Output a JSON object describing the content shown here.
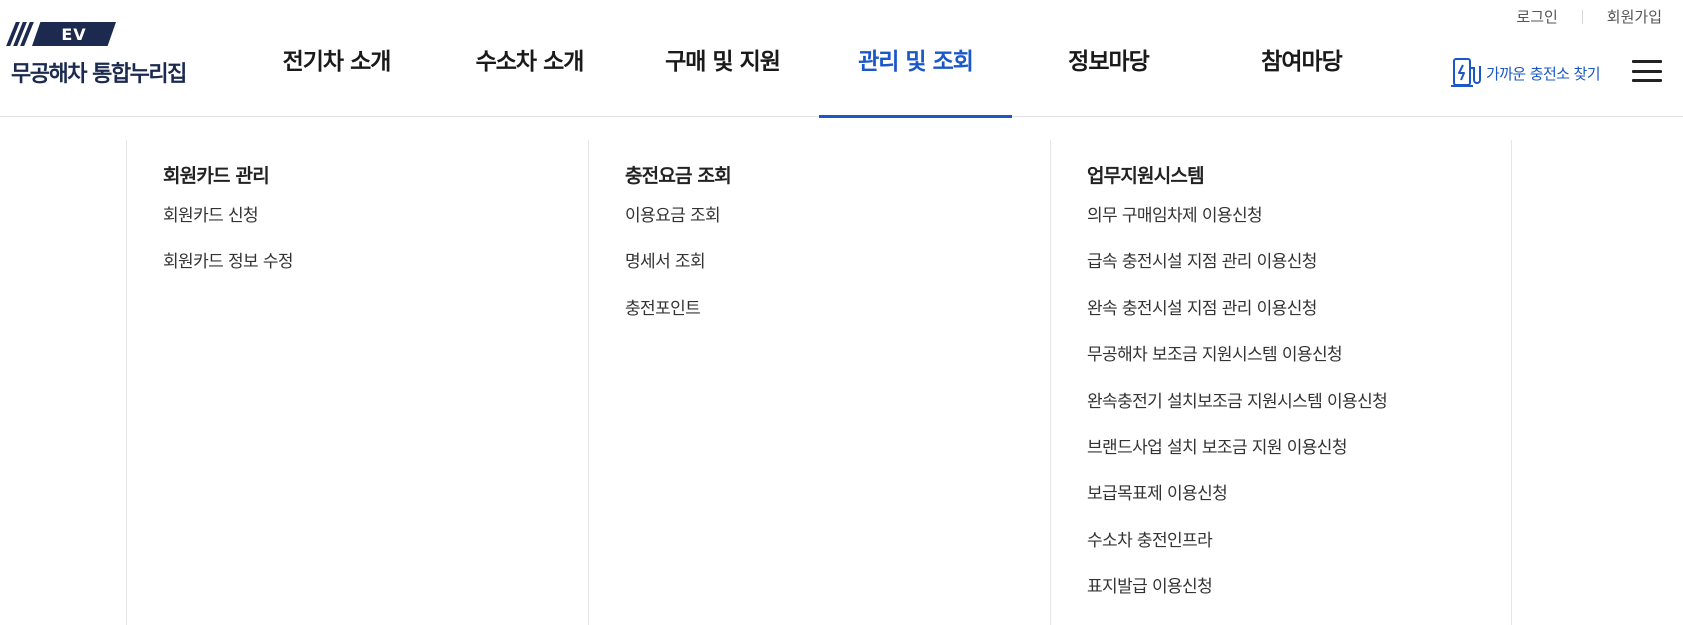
{
  "util": {
    "login": "로그인",
    "signup": "회원가입"
  },
  "logo": {
    "mark": "EV",
    "text": "무공해차 통합누리집"
  },
  "gnb": [
    {
      "label": "전기차 소개"
    },
    {
      "label": "수소차 소개"
    },
    {
      "label": "구매 및 지원"
    },
    {
      "label": "관리 및 조회",
      "active": true
    },
    {
      "label": "정보마당"
    },
    {
      "label": "참여마당"
    }
  ],
  "finder": {
    "label": "가까운 충전소 찾기",
    "icon": "charger-icon"
  },
  "menu": {
    "icon": "hamburger-menu-icon"
  },
  "submenu": [
    {
      "title": "회원카드 관리",
      "items": [
        "회원카드 신청",
        "회원카드 정보 수정"
      ]
    },
    {
      "title": "충전요금 조회",
      "items": [
        "이용요금 조회",
        "명세서 조회",
        "충전포인트"
      ]
    },
    {
      "title": "업무지원시스템",
      "items": [
        "의무 구매임차제 이용신청",
        "급속 충전시설 지점 관리 이용신청",
        "완속 충전시설 지점 관리 이용신청",
        "무공해차 보조금 지원시스템 이용신청",
        "완속충전기 설치보조금 지원시스템 이용신청",
        "브랜드사업 설치 보조금 지원 이용신청",
        "보급목표제 이용신청",
        "수소차 충전인프라",
        "표지발급 이용신청"
      ]
    }
  ],
  "colors": {
    "brand_navy": "#1b2a4e",
    "accent_blue": "#1b57c9"
  }
}
